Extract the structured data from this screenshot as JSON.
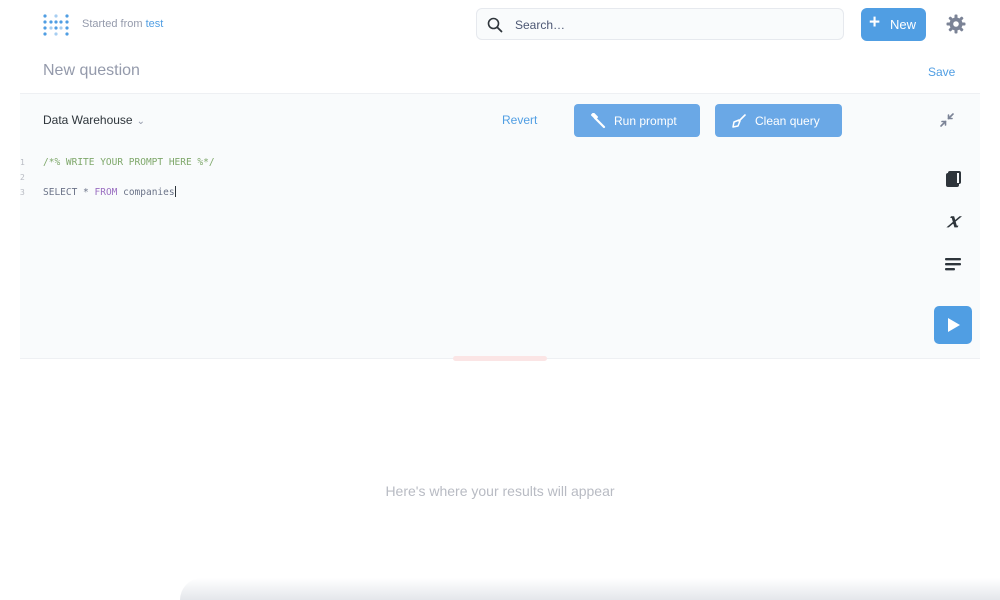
{
  "topbar": {
    "logo_icon": "metabase-logo",
    "breadcrumb_prefix": "Started from",
    "breadcrumb_link": "test",
    "search": {
      "placeholder": "Search…",
      "value": ""
    },
    "new_button": "New",
    "settings_icon": "gear-icon"
  },
  "header": {
    "title": "New question",
    "save_label": "Save"
  },
  "editor": {
    "database": "Data Warehouse",
    "revert_label": "Revert",
    "run_prompt_label": "Run prompt",
    "clean_query_label": "Clean query",
    "line_numbers": [
      "1",
      "2",
      "3"
    ],
    "lines": {
      "l1": "/*% WRITE YOUR PROMPT HERE %*/",
      "l2": "",
      "l3_kw1": "SELECT",
      "l3_mid": " * ",
      "l3_kw2": "FROM",
      "l3_tail": " companies"
    },
    "tools": [
      "book-icon",
      "variable-icon",
      "snippet-icon"
    ],
    "variable_glyph": "𝑥",
    "run_icon": "play-icon"
  },
  "results": {
    "empty_message": "Here's where your results will appear"
  },
  "colors": {
    "brand": "#509ee3",
    "button_blue": "#6aa8e6",
    "muted_text": "#949aab",
    "editor_bg": "#f9fbfc"
  }
}
